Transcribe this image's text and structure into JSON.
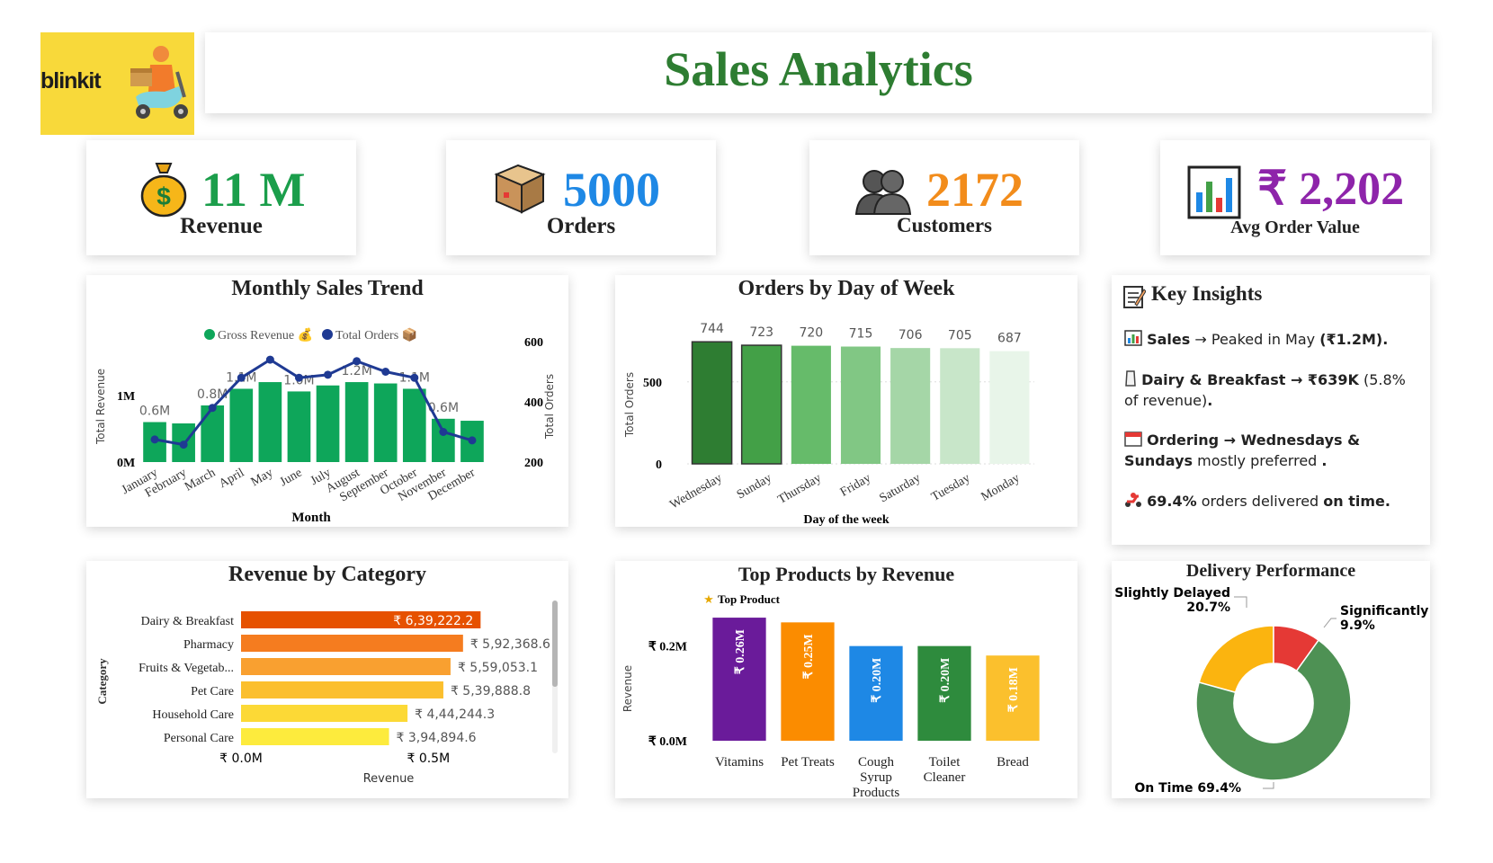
{
  "brand": {
    "logo_text": "blinkit"
  },
  "header": {
    "title": "Sales Analytics"
  },
  "kpis": [
    {
      "value": "11 M",
      "label": "Revenue",
      "icon": "money-bag-icon",
      "color": "#1b9e4b"
    },
    {
      "value": "5000",
      "label": "Orders",
      "icon": "package-icon",
      "color": "#1e88e5"
    },
    {
      "value": "2172",
      "label": "Customers",
      "icon": "customers-icon",
      "color": "#f28c1b"
    },
    {
      "value": "₹ 2,202",
      "label": "Avg Order Value",
      "icon": "bar-chart-icon",
      "color": "#8e24aa"
    }
  ],
  "monthly": {
    "title": "Monthly Sales Trend",
    "legend": [
      "Gross Revenue 💰",
      "Total Orders 📦"
    ],
    "xlabel": "Month",
    "ylabel_left": "Total Revenue",
    "ylabel_right": "Total Orders",
    "left_ticks": [
      "0M",
      "1M"
    ],
    "right_ticks": [
      "200",
      "400",
      "600"
    ]
  },
  "dow": {
    "title": "Orders by Day of Week",
    "xlabel": "Day of the week",
    "ylabel": "Total Orders",
    "ticks": [
      "0",
      "500"
    ]
  },
  "category": {
    "title": "Revenue by Category",
    "xlabel": "Revenue",
    "ylabel": "Category",
    "ticks": [
      "₹ 0.0M",
      "₹ 0.5M"
    ]
  },
  "products": {
    "title": "Top Products by Revenue",
    "legend": "Top Product",
    "ylabel": "Revenue",
    "ticks": [
      "₹ 0.0M",
      "₹ 0.2M"
    ]
  },
  "insights": {
    "title": "Key Insights",
    "title_icon": "memo-icon",
    "items": [
      {
        "icon": "chart-icon",
        "pre_bold": "Sales",
        "text": " → Peaked in May ",
        "bold": "(₹1.2M)",
        "post": "."
      },
      {
        "icon": "milk-icon",
        "pre_bold": "Dairy & Breakfast → ₹639K",
        "text": " (5.8% of revenue)",
        "bold": "",
        "post": "."
      },
      {
        "icon": "calendar-icon",
        "pre_bold": "Ordering → Wednesdays & Sundays",
        "text": " mostly preferred ",
        "bold": "",
        "post": "."
      },
      {
        "icon": "scooter-icon",
        "pre_bold": "69.4%",
        "text": " orders delivered ",
        "bold": "on time",
        "post": "."
      }
    ]
  },
  "delivery": {
    "title": "Delivery Performance"
  },
  "chart_data": [
    {
      "type": "bar+line",
      "title": "Monthly Sales Trend",
      "categories": [
        "January",
        "February",
        "March",
        "April",
        "May",
        "June",
        "July",
        "August",
        "September",
        "October",
        "November",
        "December"
      ],
      "series": [
        {
          "name": "Gross Revenue 💰",
          "kind": "bar",
          "axis": "left",
          "color": "#0ea65a",
          "values": [
            0.6,
            0.58,
            0.85,
            1.1,
            1.2,
            1.06,
            1.15,
            1.2,
            1.18,
            1.1,
            0.65,
            0.62
          ],
          "labels": [
            "0.6M",
            "",
            "0.8M",
            "1.1M",
            "",
            "1.0M",
            "",
            "1.2M",
            "",
            "1.1M",
            "0.6M",
            ""
          ]
        },
        {
          "name": "Total Orders 📦",
          "kind": "line",
          "axis": "right",
          "color": "#1f3a93",
          "values": [
            275,
            258,
            380,
            480,
            540,
            480,
            490,
            535,
            500,
            480,
            300,
            272
          ]
        }
      ],
      "xlabel": "Month",
      "ylabel": "Total Revenue",
      "y2label": "Total Orders",
      "ylim": [
        0,
        1.7
      ],
      "y2lim": [
        200,
        600
      ]
    },
    {
      "type": "bar",
      "title": "Orders by Day of Week",
      "categories": [
        "Wednesday",
        "Sunday",
        "Thursday",
        "Friday",
        "Saturday",
        "Tuesday",
        "Monday"
      ],
      "values": [
        744,
        723,
        720,
        715,
        706,
        705,
        687
      ],
      "colors": [
        "#2e7d32",
        "#43a047",
        "#66bb6a",
        "#81c784",
        "#a5d6a7",
        "#c8e6c9",
        "#e8f5e9"
      ],
      "xlabel": "Day of the week",
      "ylabel": "Total Orders",
      "ylim": [
        0,
        800
      ]
    },
    {
      "type": "bar",
      "orientation": "horizontal",
      "title": "Revenue by Category",
      "categories": [
        "Dairy & Breakfast",
        "Pharmacy",
        "Fruits & Vegetab...",
        "Pet Care",
        "Household Care",
        "Personal Care"
      ],
      "values": [
        639222.2,
        592368.6,
        559053.1,
        539888.8,
        444244.3,
        394894.6
      ],
      "labels": [
        "₹ 6,39,222.2",
        "₹ 5,92,368.6",
        "₹ 5,59,053.1",
        "₹ 5,39,888.8",
        "₹ 4,44,244.3",
        "₹ 3,94,894.6"
      ],
      "colors": [
        "#e65100",
        "#f57c1f",
        "#f9a030",
        "#fbbf2e",
        "#fcd936",
        "#fdeb3d"
      ],
      "xlabel": "Revenue",
      "ylabel": "Category",
      "xlim": [
        0,
        0.9
      ]
    },
    {
      "type": "bar",
      "title": "Top Products by Revenue",
      "categories": [
        "Vitamins",
        "Pet Treats",
        "Cough Syrup Products",
        "Toilet Cleaner",
        "Bread"
      ],
      "values": [
        0.26,
        0.25,
        0.2,
        0.2,
        0.18
      ],
      "labels": [
        "₹ 0.26M",
        "₹ 0.25M",
        "₹ 0.20M",
        "₹ 0.20M",
        "₹ 0.18M"
      ],
      "colors": [
        "#6a1b9a",
        "#fb8c00",
        "#1e88e5",
        "#2e8b3d",
        "#fbc02d"
      ],
      "ylabel": "Revenue",
      "ylim": [
        0,
        0.3
      ]
    },
    {
      "type": "pie",
      "title": "Delivery Performance",
      "labels": [
        "On Time",
        "Slightly Delayed",
        "Significantly ..."
      ],
      "values": [
        69.4,
        20.7,
        9.9
      ],
      "value_labels": [
        "69.4%",
        "20.7%",
        "9.9%"
      ],
      "colors": [
        "#4e9154",
        "#fbb40f",
        "#e53935"
      ]
    }
  ]
}
